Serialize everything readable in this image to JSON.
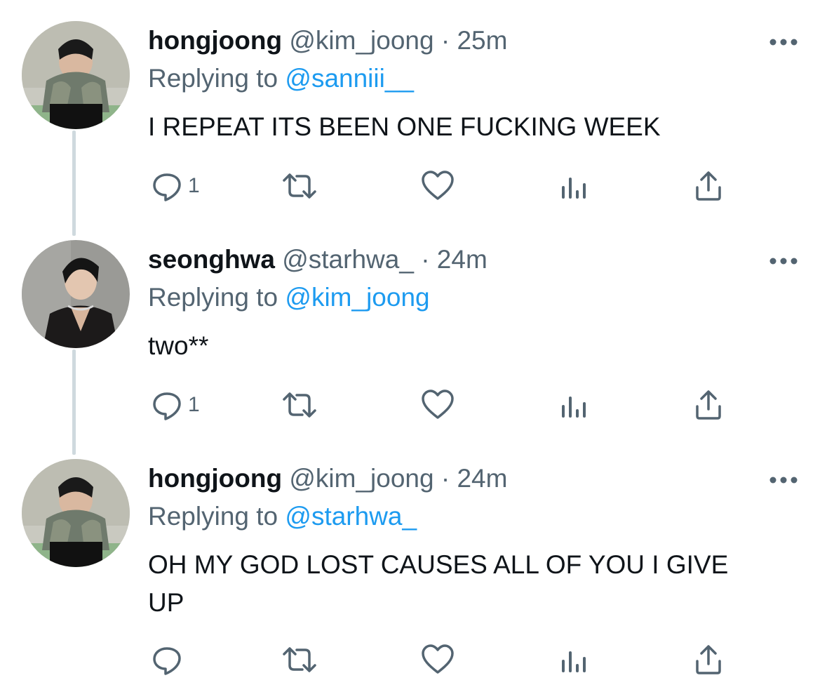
{
  "colors": {
    "text": "#0f1419",
    "secondary": "#536471",
    "link": "#1d9bf0",
    "thread_line": "#cfd9de"
  },
  "icons": [
    "more-icon",
    "reply-icon",
    "retweet-icon",
    "like-icon",
    "views-icon",
    "share-icon"
  ],
  "tweets": [
    {
      "name": "hongjoong",
      "handle": "@kim_joong",
      "separator": "·",
      "time": "25m",
      "replying_prefix": "Replying to",
      "replying_to": "@sanniii__",
      "text": "I REPEAT ITS BEEN ONE FUCKING WEEK",
      "reply_count": "1"
    },
    {
      "name": "seonghwa",
      "handle": "@starhwa_",
      "separator": "·",
      "time": "24m",
      "replying_prefix": "Replying to",
      "replying_to": "@kim_joong",
      "text": "two**",
      "reply_count": "1"
    },
    {
      "name": "hongjoong",
      "handle": "@kim_joong",
      "separator": "·",
      "time": "24m",
      "replying_prefix": "Replying to",
      "replying_to": "@starhwa_",
      "text": "OH MY GOD LOST CAUSES ALL OF YOU I GIVE UP",
      "reply_count": ""
    }
  ]
}
